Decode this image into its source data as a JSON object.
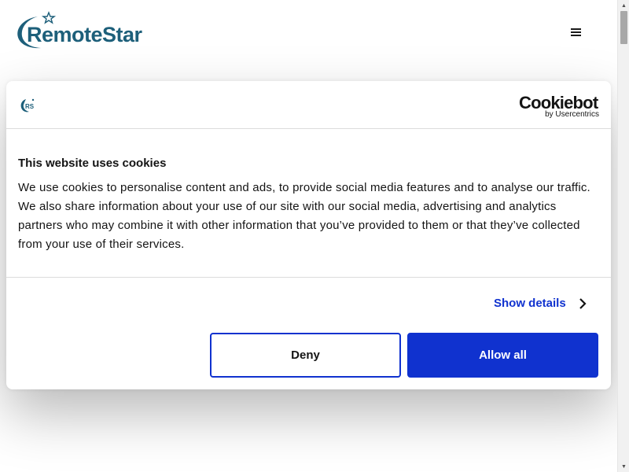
{
  "header": {
    "logo_text": "RemoteStar",
    "menu_icon": "hamburger-menu-icon"
  },
  "colors": {
    "brand": "#1d5f7a",
    "accent": "#1032cf",
    "text": "#141414"
  },
  "cookie_dialog": {
    "site_logo_icon": "rs-logo-icon",
    "provider_name": "Cookiebot",
    "provider_sub": "by Usercentrics",
    "title": "This website uses cookies",
    "body": "We use cookies to personalise content and ads, to provide social media features and to analyse our traffic. We also share information about your use of our site with our social media, advertising and analytics partners who may combine it with other information that you’ve provided to them or that they’ve collected from your use of their services.",
    "show_details_label": "Show details",
    "deny_label": "Deny",
    "allow_all_label": "Allow all"
  }
}
